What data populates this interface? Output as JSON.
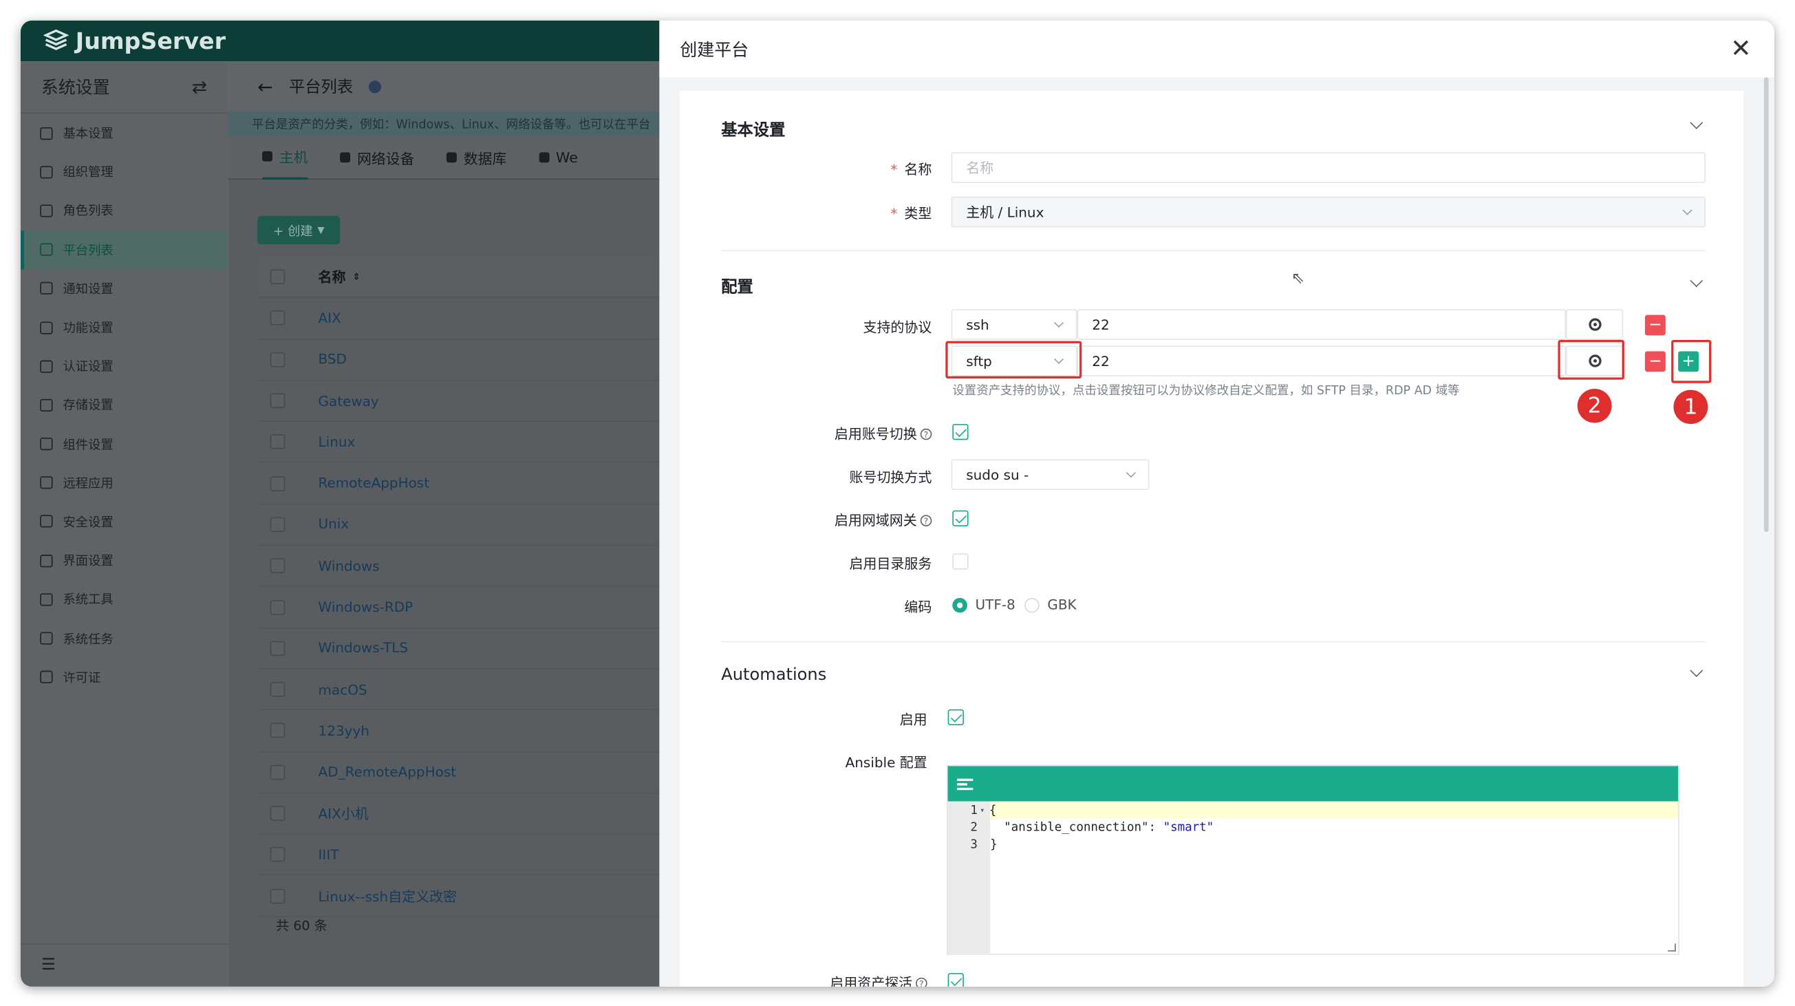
{
  "app": {
    "logo_text": "JumpServer"
  },
  "sidebar": {
    "title": "系统设置",
    "items": [
      {
        "label": "基本设置",
        "icon": "grid-icon"
      },
      {
        "label": "组织管理",
        "icon": "org-icon"
      },
      {
        "label": "角色列表",
        "icon": "role-icon"
      },
      {
        "label": "平台列表",
        "icon": "platform-icon",
        "active": true
      },
      {
        "label": "通知设置",
        "icon": "bell-icon"
      },
      {
        "label": "功能设置",
        "icon": "feature-icon"
      },
      {
        "label": "认证设置",
        "icon": "auth-icon"
      },
      {
        "label": "存储设置",
        "icon": "storage-icon"
      },
      {
        "label": "组件设置",
        "icon": "component-icon"
      },
      {
        "label": "远程应用",
        "icon": "remote-app-icon"
      },
      {
        "label": "安全设置",
        "icon": "shield-icon"
      },
      {
        "label": "界面设置",
        "icon": "ui-icon"
      },
      {
        "label": "系统工具",
        "icon": "tools-icon"
      },
      {
        "label": "系统任务",
        "icon": "tasks-icon"
      },
      {
        "label": "许可证",
        "icon": "license-icon"
      }
    ]
  },
  "main": {
    "title": "平台列表",
    "banner": "平台是资产的分类，例如：Windows、Linux、网络设备等。也可以在平台",
    "tabs": [
      "主机",
      "网络设备",
      "数据库",
      "We"
    ],
    "create_label": "+ 创建",
    "table_header": "名称",
    "rows": [
      "AIX",
      "BSD",
      "Gateway",
      "Linux",
      "RemoteAppHost",
      "Unix",
      "Windows",
      "Windows-RDP",
      "Windows-TLS",
      "macOS",
      "123yyh",
      "AD_RemoteAppHost",
      "AIX小机",
      "IIIT",
      "Linux--ssh自定义改密"
    ],
    "total": "共 60 条"
  },
  "drawer": {
    "title": "创建平台",
    "basic": {
      "section": "基本设置",
      "name_label": "名称",
      "name_placeholder": "名称",
      "type_label": "类型",
      "type_value": "主机 / Linux"
    },
    "config": {
      "section": "配置",
      "protocols_label": "支持的协议",
      "protocols": [
        {
          "name": "ssh",
          "port": "22"
        },
        {
          "name": "sftp",
          "port": "22"
        }
      ],
      "protocols_help": "设置资产支持的协议，点击设置按钮可以为协议修改自定义配置，如 SFTP 目录，RDP AD 域等",
      "su_enabled_label": "启用账号切换",
      "su_enabled": true,
      "su_method_label": "账号切换方式",
      "su_method_value": "sudo su -",
      "domain_enabled_label": "启用网域网关",
      "domain_enabled": true,
      "ds_enabled_label": "启用目录服务",
      "ds_enabled": false,
      "charset_label": "编码",
      "charset_options": [
        "UTF-8",
        "GBK"
      ],
      "charset_selected": "UTF-8"
    },
    "automations": {
      "section": "Automations",
      "enable_label": "启用",
      "enabled": true,
      "ansible_label": "Ansible 配置",
      "code_lines": [
        {
          "no": "1",
          "text": "{"
        },
        {
          "no": "2",
          "key": "\"ansible_connection\"",
          "value": "\"smart\""
        },
        {
          "no": "3",
          "text": "}"
        }
      ],
      "gather_facts_label": "启用资产探活",
      "gather_facts": true
    },
    "annotations": [
      "1",
      "2"
    ]
  },
  "colors": {
    "accent": "#1aab8a",
    "danger": "#f04f59",
    "annotation": "#e02d2d",
    "overlay": "#5f6366"
  }
}
